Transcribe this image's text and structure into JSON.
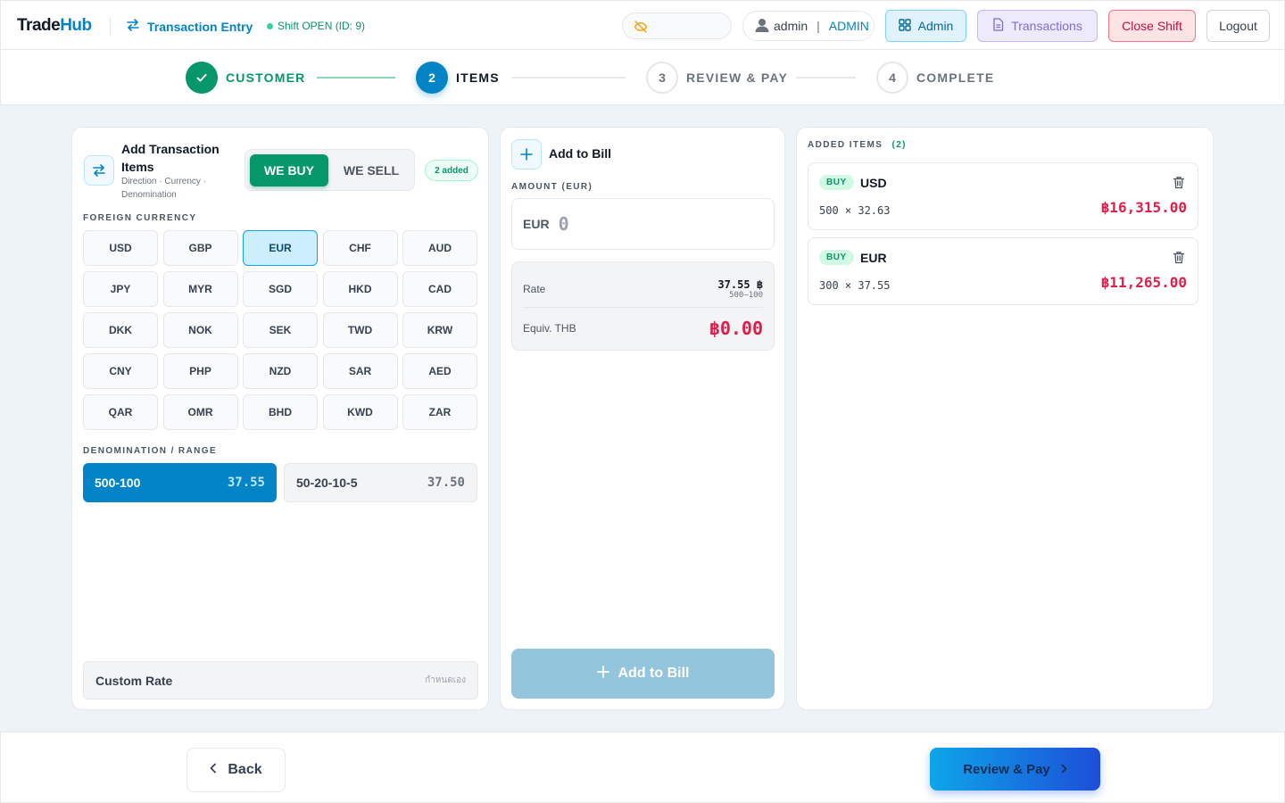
{
  "header": {
    "logo_trade": "Trade",
    "logo_hub": "Hub",
    "title": "Transaction Entry",
    "shift_status": "Shift OPEN (ID: 9)",
    "user_name": "admin",
    "user_separator": "|",
    "user_role": "ADMIN",
    "admin_label": "Admin",
    "transactions_label": "Transactions",
    "close_shift_label": "Close Shift",
    "logout_label": "Logout"
  },
  "stepper": {
    "steps": [
      {
        "number": "",
        "label": "CUSTOMER",
        "state": "done"
      },
      {
        "number": "2",
        "label": "ITEMS",
        "state": "active"
      },
      {
        "number": "3",
        "label": "REVIEW & PAY",
        "state": "todo"
      },
      {
        "number": "4",
        "label": "COMPLETE",
        "state": "todo"
      }
    ]
  },
  "items_panel": {
    "title": "Add Transaction Items",
    "subtitle": "Direction · Currency · Denomination",
    "direction_buy": "WE BUY",
    "direction_sell": "WE SELL",
    "selected_direction": "WE BUY",
    "added_badge": "2 added",
    "currency_section_label": "FOREIGN CURRENCY",
    "currencies": [
      "USD",
      "GBP",
      "EUR",
      "CHF",
      "AUD",
      "JPY",
      "MYR",
      "SGD",
      "HKD",
      "CAD",
      "DKK",
      "NOK",
      "SEK",
      "TWD",
      "KRW",
      "CNY",
      "PHP",
      "NZD",
      "SAR",
      "AED",
      "QAR",
      "OMR",
      "BHD",
      "KWD",
      "ZAR"
    ],
    "selected_currency": "EUR",
    "denomination_section_label": "DENOMINATION / RANGE",
    "denominations": [
      {
        "range": "500-100",
        "rate": "37.55",
        "selected": true
      },
      {
        "range": "50-20-10-5",
        "rate": "37.50",
        "selected": false
      }
    ],
    "custom_rate_label": "Custom Rate",
    "custom_rate_hint": "กำหนดเอง"
  },
  "add_panel": {
    "title": "Add to Bill",
    "amount_label": "AMOUNT (EUR)",
    "currency_code": "EUR",
    "amount_placeholder": "0",
    "rate_label": "Rate",
    "rate_value": "37.55 ฿",
    "rate_range": "500–100",
    "equiv_label": "Equiv. THB",
    "equiv_value": "฿0.00",
    "add_button_label": "Add to Bill"
  },
  "added_panel": {
    "title": "ADDED ITEMS",
    "count": "(2)",
    "items": [
      {
        "direction": "BUY",
        "currency": "USD",
        "calc": "500 × 32.63",
        "amount": "฿16,315.00"
      },
      {
        "direction": "BUY",
        "currency": "EUR",
        "calc": "300 × 37.55",
        "amount": "฿11,265.00"
      }
    ]
  },
  "footer": {
    "back_label": "Back",
    "review_label": "Review & Pay"
  },
  "colors": {
    "brand": "#0284c7",
    "buy_green": "#059669",
    "amount_red": "#e11d48"
  }
}
